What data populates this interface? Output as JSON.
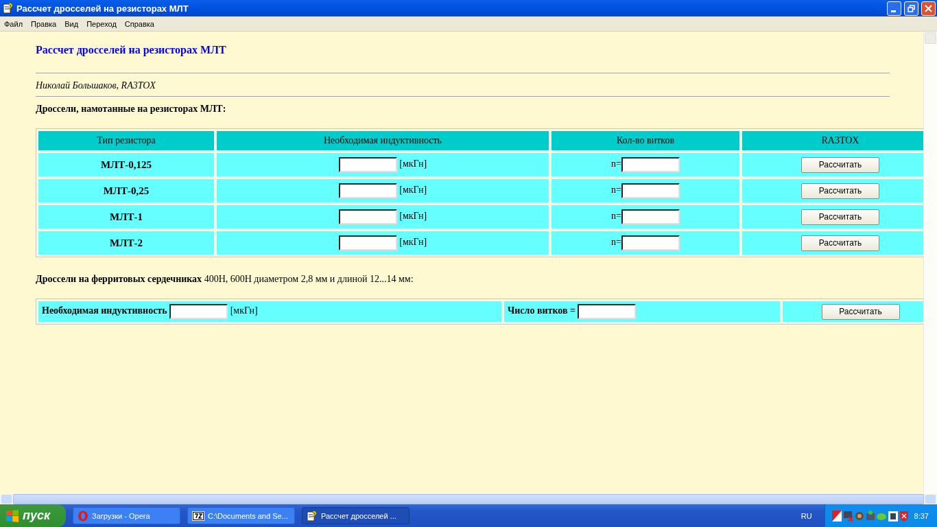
{
  "window": {
    "title": "Рассчет дросселей на резисторах МЛТ"
  },
  "menu": [
    "Файл",
    "Правка",
    "Вид",
    "Переход",
    "Справка"
  ],
  "page": {
    "heading": "Рассчет дросселей на резисторах МЛТ",
    "author": "Николай Большаков, RA3TOX",
    "section_1": "Дроссели, намотанные на резисторах МЛТ:",
    "table_1": {
      "columns": [
        "Тип резистора",
        "Необходимая индуктивность",
        "Кол-во витков",
        "RA3TOX"
      ],
      "rows": [
        {
          "type": "МЛТ-0,125",
          "unit": "[мкГн]",
          "turns_label": "n=",
          "button": "Рассчитать"
        },
        {
          "type": "МЛТ-0,25",
          "unit": "[мкГн]",
          "turns_label": "n=",
          "button": "Рассчитать"
        },
        {
          "type": "МЛТ-1",
          "unit": "[мкГн]",
          "turns_label": "n=",
          "button": "Рассчитать"
        },
        {
          "type": "МЛТ-2",
          "unit": "[мкГн]",
          "turns_label": "n=",
          "button": "Рассчитать"
        }
      ]
    },
    "section_2": "**Дроссели на ферритовых сердечниках** 400Н, 600Н диаметром 2,8 мм и длиной 12...14 мм:",
    "table_2": {
      "inductance_label": "Необходимая индуктивность",
      "unit": "[мкГн]",
      "turns_label": "Число витков =",
      "button": "Рассчитать"
    }
  },
  "taskbar": {
    "start": "пуск",
    "tasks": [
      {
        "label": "Загрузки - Opera",
        "kind": "opera",
        "selected": false
      },
      {
        "label": "C:\\Documents and Se...",
        "kind": "archive",
        "selected": false
      },
      {
        "label": "Рассчет дросселей ...",
        "kind": "app",
        "selected": true
      }
    ],
    "language": "RU",
    "clock": "8:37"
  }
}
